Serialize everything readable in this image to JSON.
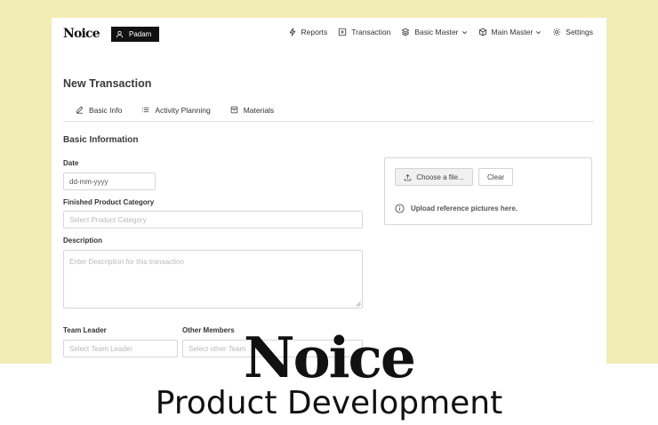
{
  "header": {
    "logo": "Noice",
    "user": "Padam",
    "nav": [
      {
        "label": "Reports",
        "icon": "lightning-icon"
      },
      {
        "label": "Transaction",
        "icon": "plus-square-icon"
      },
      {
        "label": "Basic Master",
        "icon": "layers-icon",
        "dropdown": true
      },
      {
        "label": "Main Master",
        "icon": "cube-icon",
        "dropdown": true
      },
      {
        "label": "Settings",
        "icon": "gear-icon"
      }
    ]
  },
  "page": {
    "title": "New Transaction",
    "tabs": [
      {
        "label": "Basic Info",
        "icon": "pencil-icon"
      },
      {
        "label": "Activity Planning",
        "icon": "list-icon"
      },
      {
        "label": "Materials",
        "icon": "box-icon"
      }
    ],
    "section_title": "Basic Information"
  },
  "form": {
    "date": {
      "label": "Date",
      "value": "dd-mm-yyyy"
    },
    "category": {
      "label": "Finished Product Category",
      "placeholder": "Select Product Category"
    },
    "description": {
      "label": "Description",
      "placeholder": "Enter Description for this transaction"
    },
    "team_leader": {
      "label": "Team Leader",
      "placeholder": "Select Team Leader"
    },
    "other_members": {
      "label": "Other Members",
      "placeholder": "Select other Team"
    }
  },
  "upload": {
    "choose_label": "Choose a file...",
    "clear_label": "Clear",
    "hint": "Upload reference pictures here."
  },
  "overlay": {
    "title": "Noice",
    "subtitle": "Product Development"
  },
  "colors": {
    "background": "#f2ecb5",
    "badge": "#111111"
  }
}
